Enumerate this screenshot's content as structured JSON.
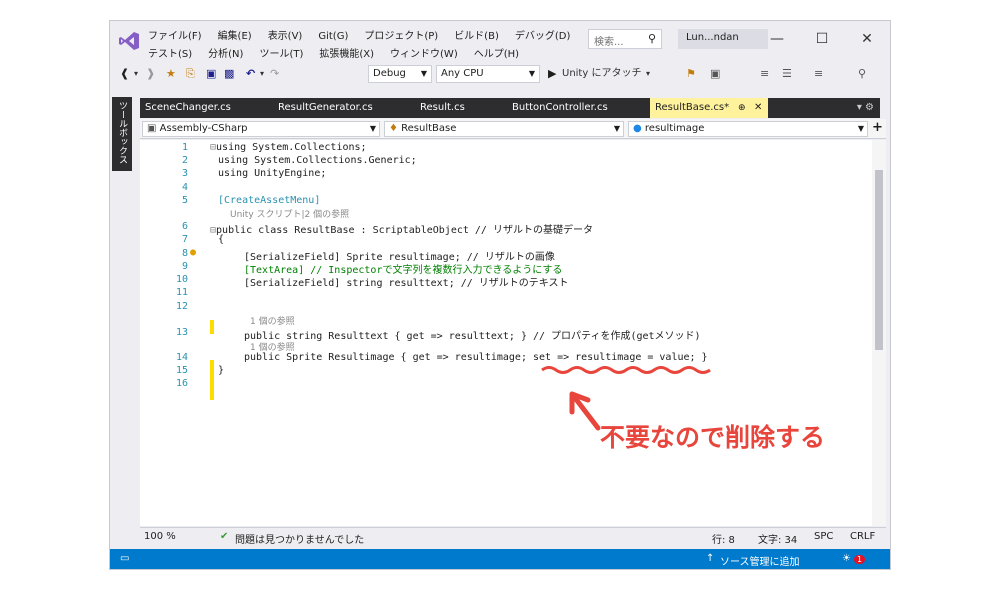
{
  "menu": {
    "row1": [
      "ファイル(F)",
      "編集(E)",
      "表示(V)",
      "Git(G)",
      "プロジェクト(P)",
      "ビルド(B)",
      "デバッグ(D)"
    ],
    "row2": [
      "テスト(S)",
      "分析(N)",
      "ツール(T)",
      "拡張機能(X)",
      "ウィンドウ(W)",
      "ヘルプ(H)"
    ]
  },
  "search": {
    "placeholder": "検索..."
  },
  "user": {
    "label": "Lun...ndan"
  },
  "toolbar": {
    "config": "Debug",
    "platform": "Any CPU",
    "run_label": "Unity にアタッチ"
  },
  "sidebar": {
    "toolbox_label": "ツールボックス"
  },
  "tabs": [
    "SceneChanger.cs",
    "ResultGenerator.cs",
    "Result.cs",
    "ButtonController.cs",
    "ResultBase.cs*"
  ],
  "navbar": {
    "project": "Assembly-CSharp",
    "class": "ResultBase",
    "member": "resultimage"
  },
  "code": {
    "l1": "using System.Collections;",
    "l2": "using System.Collections.Generic;",
    "l3": "using UnityEngine;",
    "l5": "[CreateAssetMenu]",
    "ref5": "Unity スクリプト|2 個の参照",
    "l6": "public class ResultBase : ScriptableObject // リザルトの基礎データ",
    "l7": "{",
    "l8": "[SerializeField] Sprite resultimage; // リザルトの画像",
    "l9": "[TextArea] // Inspectorで文字列を複数行入力できるようにする",
    "l10": "[SerializeField] string resulttext; // リザルトのテキスト",
    "ref13": "1 個の参照",
    "l13": "public string Resulttext { get => resulttext; } // プロパティを作成(getメソッド)",
    "ref14": "1 個の参照",
    "l14": "public Sprite Resultimage { get => resultimage; set => resultimage = value; }",
    "l15": "}"
  },
  "line_numbers": [
    "1",
    "2",
    "3",
    "4",
    "5",
    "6",
    "7",
    "8",
    "9",
    "10",
    "11",
    "12",
    "13",
    "14",
    "15",
    "16"
  ],
  "bottombar": {
    "zoom": "100 %",
    "status": "問題は見つかりませんでした",
    "line": "行: 8",
    "char": "文字: 34",
    "spc": "SPC",
    "crlf": "CRLF"
  },
  "statusbar": {
    "source_control": "ソース管理に追加",
    "notifications": "1"
  },
  "annotation": {
    "text": "不要なので削除する"
  },
  "colors": {
    "accent": "#007acc",
    "annotation": "#e8453c",
    "active_tab": "#fff29d"
  }
}
